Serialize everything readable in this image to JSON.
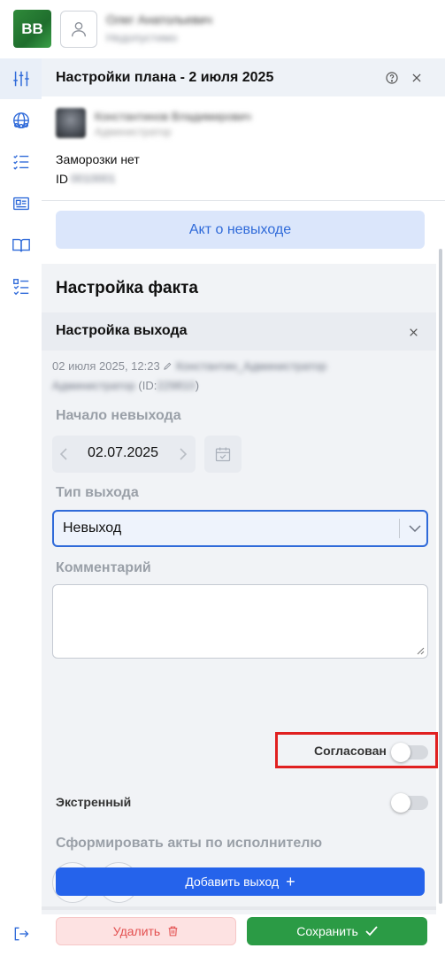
{
  "header": {
    "logo_text": "BB",
    "user_name": "Олег Анатольевич",
    "user_role": "Недопустимо"
  },
  "rail": {
    "items": [
      {
        "icon": "sliders-icon",
        "active": true
      },
      {
        "icon": "globe-people-icon",
        "active": false
      },
      {
        "icon": "checklist-icon",
        "active": false
      },
      {
        "icon": "id-card-icon",
        "active": false
      },
      {
        "icon": "book-icon",
        "active": false
      },
      {
        "icon": "task-list-icon",
        "active": false
      }
    ],
    "logout_icon": "logout-icon"
  },
  "panel": {
    "title": "Настройки плана - 2 июля 2025",
    "employee": {
      "name": "Константинов Владимирович",
      "role": "Администратор",
      "freeze_text": "Заморозки нет",
      "id_label": "ID",
      "id_value": "0010001"
    },
    "act_button": "Акт о невыходе",
    "fact": {
      "title": "Настройка факта",
      "exit_title": "Настройка выхода",
      "meta_date": "02 июля 2025, 12:23",
      "meta_author": "Константин_Администратор",
      "meta_role": "Администратор",
      "meta_id": "(ID:",
      "meta_id_value": "229810",
      "meta_id_close": ")",
      "start_label": "Начало невыхода",
      "start_date": "02.07.2025",
      "type_label": "Тип выхода",
      "type_value": "Невыход",
      "comment_label": "Комментарий",
      "comment_value": "",
      "agreed_label": "Согласован",
      "agreed_on": false,
      "urgent_label": "Экстренный",
      "urgent_on": false,
      "acts_label": "Сформировать акты по исполнителю",
      "add_exit_button": "Добавить выход"
    },
    "footer": {
      "delete_button": "Удалить",
      "save_button": "Сохранить"
    }
  },
  "colors": {
    "accent": "#2563eb",
    "save": "#2b9b45",
    "delete": "#e35050",
    "highlight": "#e02020"
  }
}
